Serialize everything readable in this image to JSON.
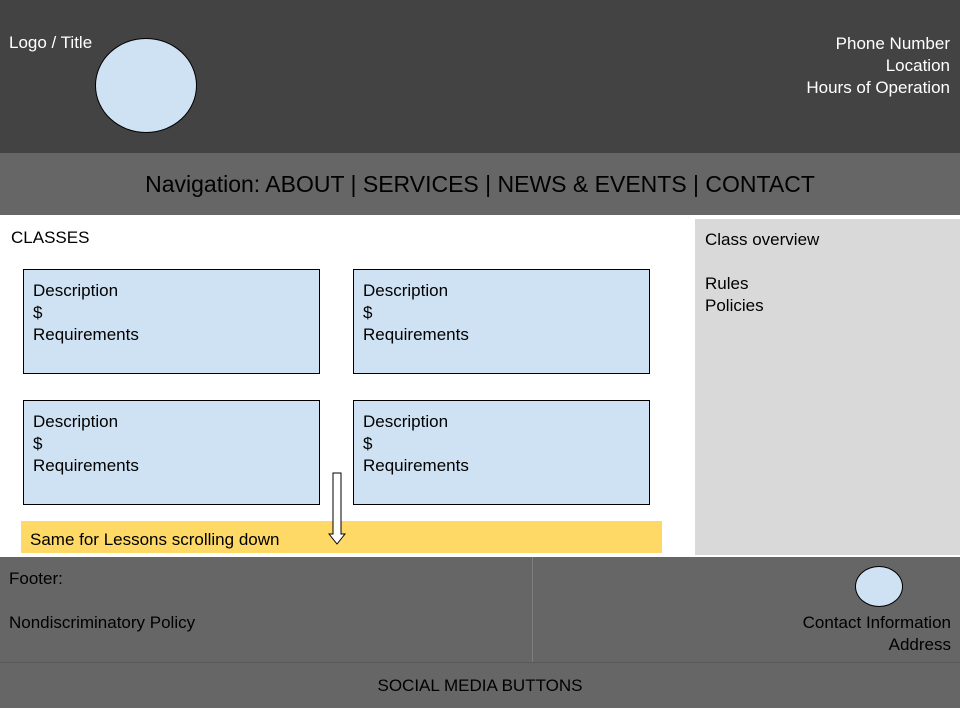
{
  "header": {
    "logo_title": "Logo / Title",
    "phone": "Phone Number",
    "location": "Location",
    "hours": "Hours of Operation"
  },
  "nav": {
    "text": "Navigation: ABOUT | SERVICES | NEWS & EVENTS | CONTACT"
  },
  "main": {
    "heading": "CLASSES",
    "cards": [
      {
        "description": "Description",
        "price": "$",
        "requirements": "Requirements"
      },
      {
        "description": "Description",
        "price": "$",
        "requirements": "Requirements"
      },
      {
        "description": "Description",
        "price": "$",
        "requirements": "Requirements"
      },
      {
        "description": "Description",
        "price": "$",
        "requirements": "Requirements"
      }
    ],
    "lessons_note": "Same for Lessons scrolling down"
  },
  "sidebar": {
    "overview": "Class overview",
    "rules": "Rules",
    "policies": "Policies"
  },
  "footer": {
    "label": "Footer:",
    "policy": "Nondiscriminatory Policy",
    "contact": "Contact Information",
    "address": "Address"
  },
  "social": {
    "label": "SOCIAL MEDIA BUTTONS"
  },
  "colors": {
    "header_bg": "#434343",
    "nav_bg": "#666666",
    "card_bg": "#cfe2f3",
    "note_bg": "#ffd966",
    "sidebar_bg": "#d9d9d9"
  }
}
